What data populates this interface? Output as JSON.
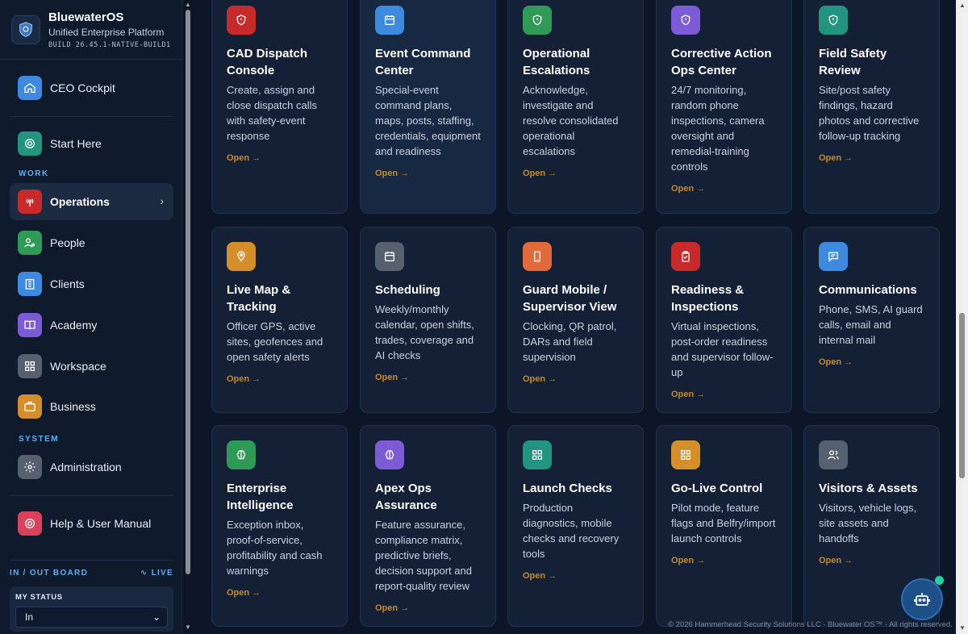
{
  "brand": {
    "name": "BluewaterOS",
    "subtitle": "Unified Enterprise Platform",
    "build": "BUILD 26.45.1-NATIVE-BUILD1..."
  },
  "nav": {
    "ceo": "CEO Cockpit",
    "start": "Start Here",
    "work_section": "WORK",
    "operations": "Operations",
    "people": "People",
    "clients": "Clients",
    "academy": "Academy",
    "workspace": "Workspace",
    "business": "Business",
    "system_section": "SYSTEM",
    "administration": "Administration",
    "help": "Help & User Manual"
  },
  "inout": {
    "title": "IN / OUT BOARD",
    "live": "LIVE",
    "my_status_label": "MY STATUS",
    "my_status_value": "In"
  },
  "cards": [
    {
      "title": "CAD Dispatch Console",
      "desc": "Create, assign and close dispatch calls with safety-event response",
      "open": "Open →",
      "color": "#c72a2a",
      "icon": "shield-icon"
    },
    {
      "title": "Event Command Center",
      "desc": "Special-event command plans, maps, posts, staffing, credentials, equipment and readiness",
      "open": "Open →",
      "color": "#3d8ae0",
      "icon": "calendar-icon"
    },
    {
      "title": "Operational Escalations",
      "desc": "Acknowledge, investigate and resolve consolidated operational escalations",
      "open": "Open →",
      "color": "#2f9a56",
      "icon": "shield-icon"
    },
    {
      "title": "Corrective Action Ops Center",
      "desc": "24/7 monitoring, random phone inspections, camera oversight and remedial-training controls",
      "open": "Open →",
      "color": "#7e5bd6",
      "icon": "shield-icon"
    },
    {
      "title": "Field Safety Review",
      "desc": "Site/post safety findings, hazard photos and corrective follow-up tracking",
      "open": "Open →",
      "color": "#23947f",
      "icon": "shield-icon"
    },
    {
      "title": "Live Map & Tracking",
      "desc": "Officer GPS, active sites, geofences and open safety alerts",
      "open": "Open →",
      "color": "#d48f2a",
      "icon": "map-pin-icon"
    },
    {
      "title": "Scheduling",
      "desc": "Weekly/monthly calendar, open shifts, trades, coverage and AI checks",
      "open": "Open →",
      "color": "#56606f",
      "icon": "calendar-icon"
    },
    {
      "title": "Guard Mobile / Supervisor View",
      "desc": "Clocking, QR patrol, DARs and field supervision",
      "open": "Open →",
      "color": "#e06a3a",
      "icon": "mobile-icon"
    },
    {
      "title": "Readiness & Inspections",
      "desc": "Virtual inspections, post-order readiness and supervisor follow-up",
      "open": "Open →",
      "color": "#c72a2a",
      "icon": "clipboard-check-icon"
    },
    {
      "title": "Communications",
      "desc": "Phone, SMS, AI guard calls, email and internal mail",
      "open": "Open →",
      "color": "#3d8ae0",
      "icon": "message-icon"
    },
    {
      "title": "Enterprise Intelligence",
      "desc": "Exception inbox, proof-of-service, profitability and cash warnings",
      "open": "Open →",
      "color": "#2f9a56",
      "icon": "brain-icon"
    },
    {
      "title": "Apex Ops Assurance",
      "desc": "Feature assurance, compliance matrix, predictive briefs, decision support and report-quality review",
      "open": "Open →",
      "color": "#7e5bd6",
      "icon": "brain-icon"
    },
    {
      "title": "Launch Checks",
      "desc": "Production diagnostics, mobile checks and recovery tools",
      "open": "Open →",
      "color": "#23947f",
      "icon": "grid-icon"
    },
    {
      "title": "Go-Live Control",
      "desc": "Pilot mode, feature flags and Belfry/import launch controls",
      "open": "Open →",
      "color": "#d48f2a",
      "icon": "grid-icon"
    },
    {
      "title": "Visitors & Assets",
      "desc": "Visitors, vehicle logs, site assets and handoffs",
      "open": "Open →",
      "color": "#56606f",
      "icon": "users-icon"
    }
  ],
  "footer": "© 2026 Hammerhead Security Solutions LLC · Bluewater OS™ · All rights reserved."
}
